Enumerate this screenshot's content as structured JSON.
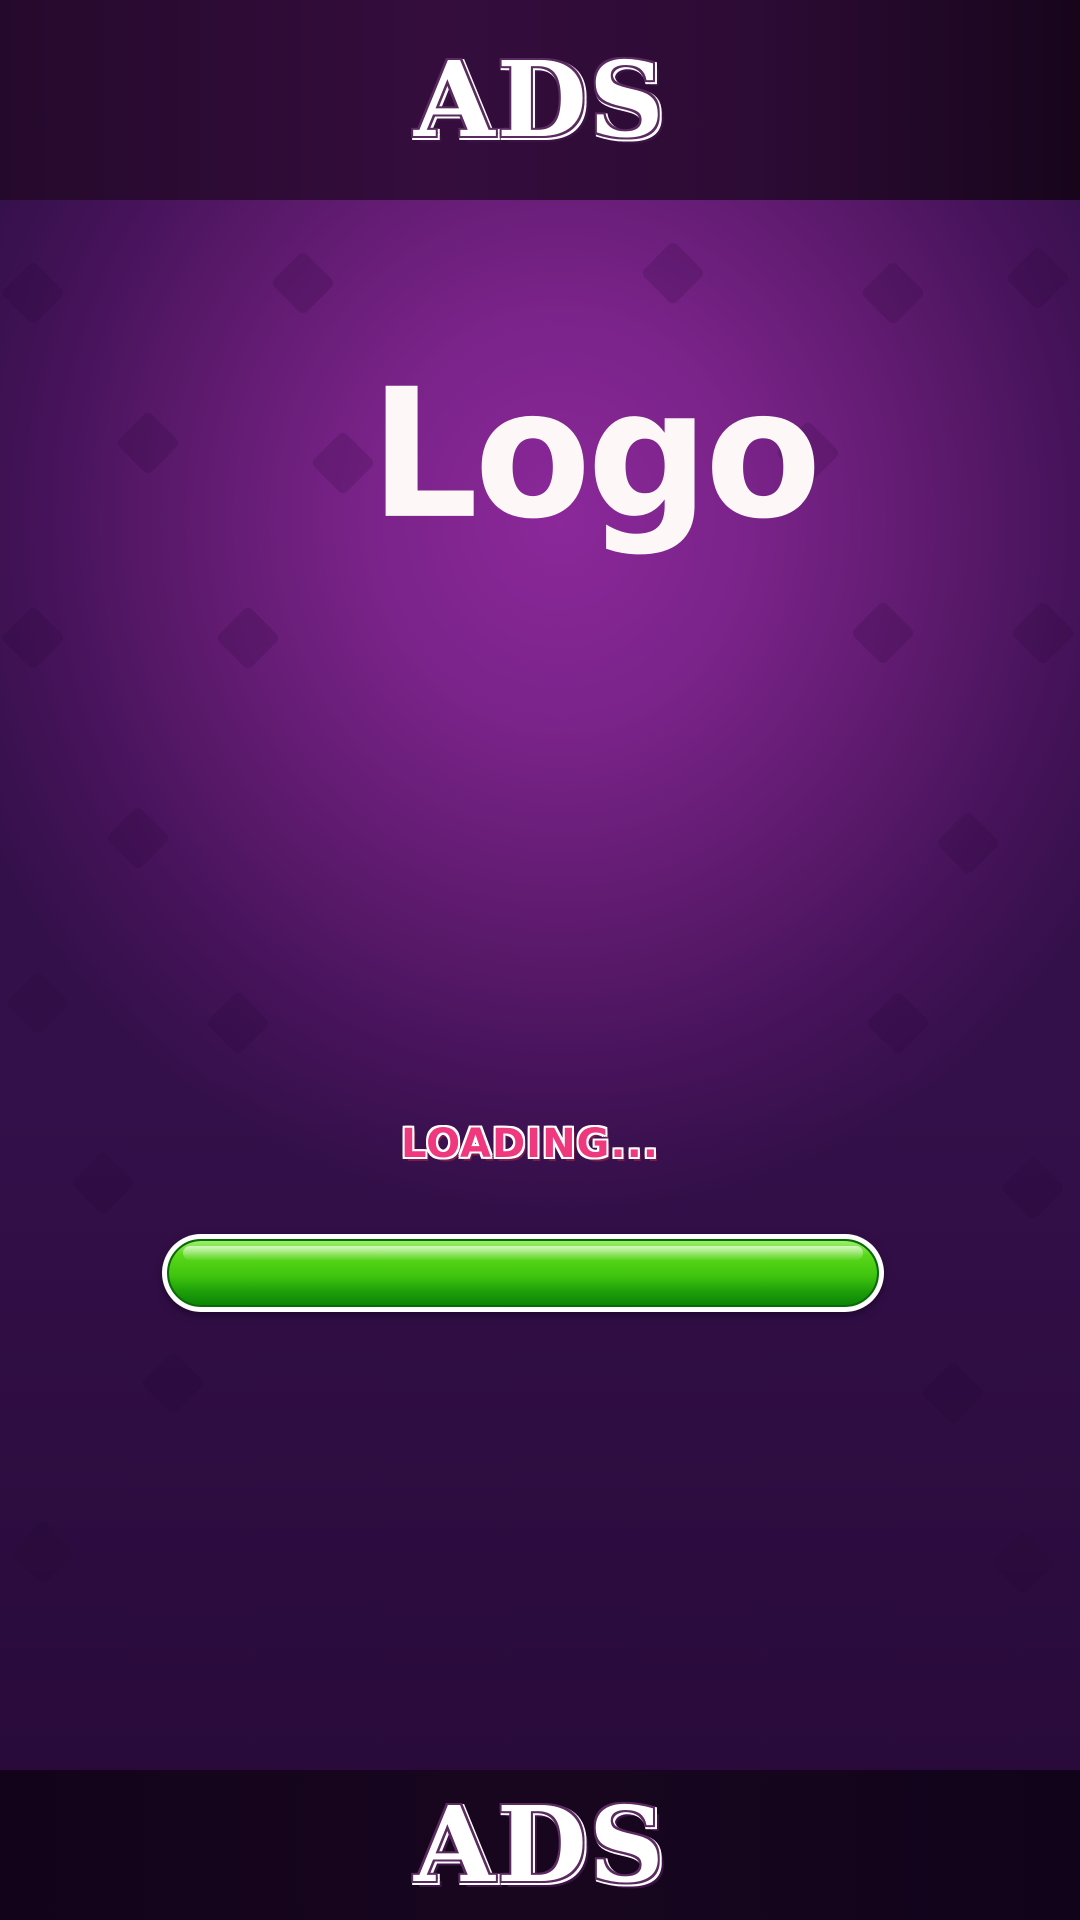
{
  "ads": {
    "top_label": "ADS",
    "bottom_label": "ADS"
  },
  "logo": {
    "text": "Logo"
  },
  "loading": {
    "label": "LOADING...",
    "progress_fraction": 1.0
  },
  "colors": {
    "background_center": "#8b289a",
    "background_edge": "#34104a",
    "ad_bar": "#25092c",
    "loading_text": "#f0387e",
    "progress_fill": "#3fc40e",
    "progress_border": "#ffffff",
    "logo_text": "#fdf7f7"
  }
}
